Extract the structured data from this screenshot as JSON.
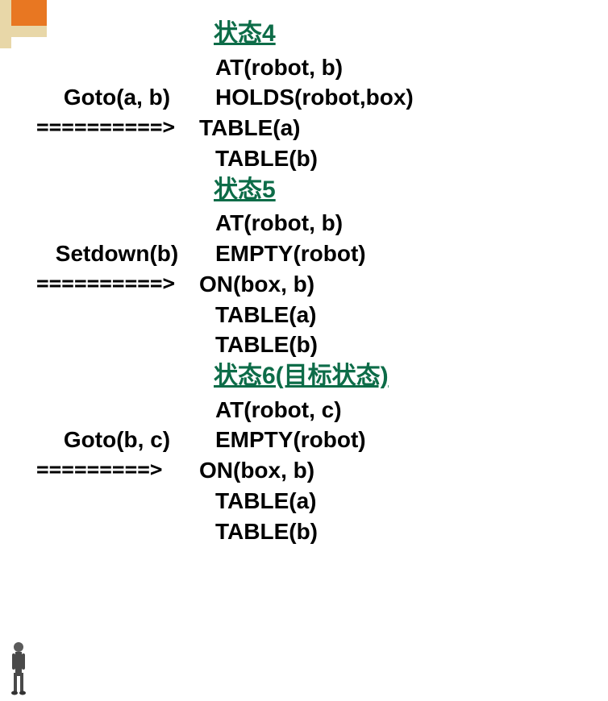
{
  "decor": {
    "orange_color": "#e87722",
    "tan_color": "#e8d7a8"
  },
  "states": [
    {
      "title": "状态4",
      "action": "Goto(a, b)",
      "arrow": "==========>",
      "predicates": [
        "AT(robot, b)",
        "HOLDS(robot,box)",
        "TABLE(a)",
        "TABLE(b)"
      ]
    },
    {
      "title": "状态5",
      "action": "Setdown(b)",
      "arrow": "==========>",
      "predicates": [
        "AT(robot, b)",
        "EMPTY(robot)",
        "ON(box, b)",
        "TABLE(a)",
        "TABLE(b)"
      ]
    },
    {
      "title": "状态6(目标状态)",
      "action": "Goto(b, c)",
      "arrow": "=========>",
      "predicates": [
        "AT(robot, c)",
        "EMPTY(robot)",
        "ON(box, b)",
        "TABLE(a)",
        "TABLE(b)"
      ]
    }
  ]
}
